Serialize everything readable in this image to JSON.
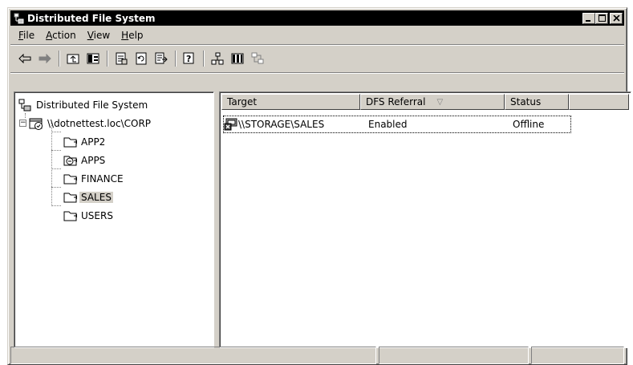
{
  "window": {
    "title": "Distributed File System",
    "title_icon": "dfs-icon",
    "controls": [
      "minimize",
      "maximize",
      "close"
    ]
  },
  "menu": {
    "items": [
      {
        "label": "File",
        "accel": "F"
      },
      {
        "label": "Action",
        "accel": "A"
      },
      {
        "label": "View",
        "accel": "V"
      },
      {
        "label": "Help",
        "accel": "H"
      }
    ]
  },
  "toolbar": {
    "buttons": [
      {
        "name": "back-icon",
        "glyph": "⇦"
      },
      {
        "name": "forward-icon",
        "glyph": "⇨"
      },
      {
        "name": "up-level-icon",
        "glyph": "⮤"
      },
      {
        "name": "show-hide-tree-icon",
        "glyph": "◧"
      },
      {
        "name": "properties-icon",
        "glyph": "🗎"
      },
      {
        "name": "refresh-icon",
        "glyph": "⟳"
      },
      {
        "name": "export-list-icon",
        "glyph": "⇥"
      },
      {
        "name": "help-icon",
        "glyph": "?"
      },
      {
        "name": "new-root-icon",
        "glyph": "⚲"
      },
      {
        "name": "columns-icon",
        "glyph": "▥"
      },
      {
        "name": "replication-icon",
        "glyph": "⚙"
      }
    ]
  },
  "tree": {
    "root_label": "Distributed File System",
    "namespace_label": "\\\\dotnettest.loc\\CORP",
    "links": [
      {
        "label": "APP2",
        "selected": false
      },
      {
        "label": "APPS",
        "selected": false
      },
      {
        "label": "FINANCE",
        "selected": false
      },
      {
        "label": "SALES",
        "selected": true
      },
      {
        "label": "USERS",
        "selected": false
      }
    ]
  },
  "list": {
    "columns": [
      "Target",
      "DFS Referral",
      "Status",
      ""
    ],
    "sorted_column": "DFS Referral",
    "rows": [
      {
        "target": "\\\\STORAGE\\SALES",
        "referral": "Enabled",
        "status": "Offline"
      }
    ]
  },
  "statusbar": {
    "panels": [
      "",
      "",
      ""
    ]
  }
}
